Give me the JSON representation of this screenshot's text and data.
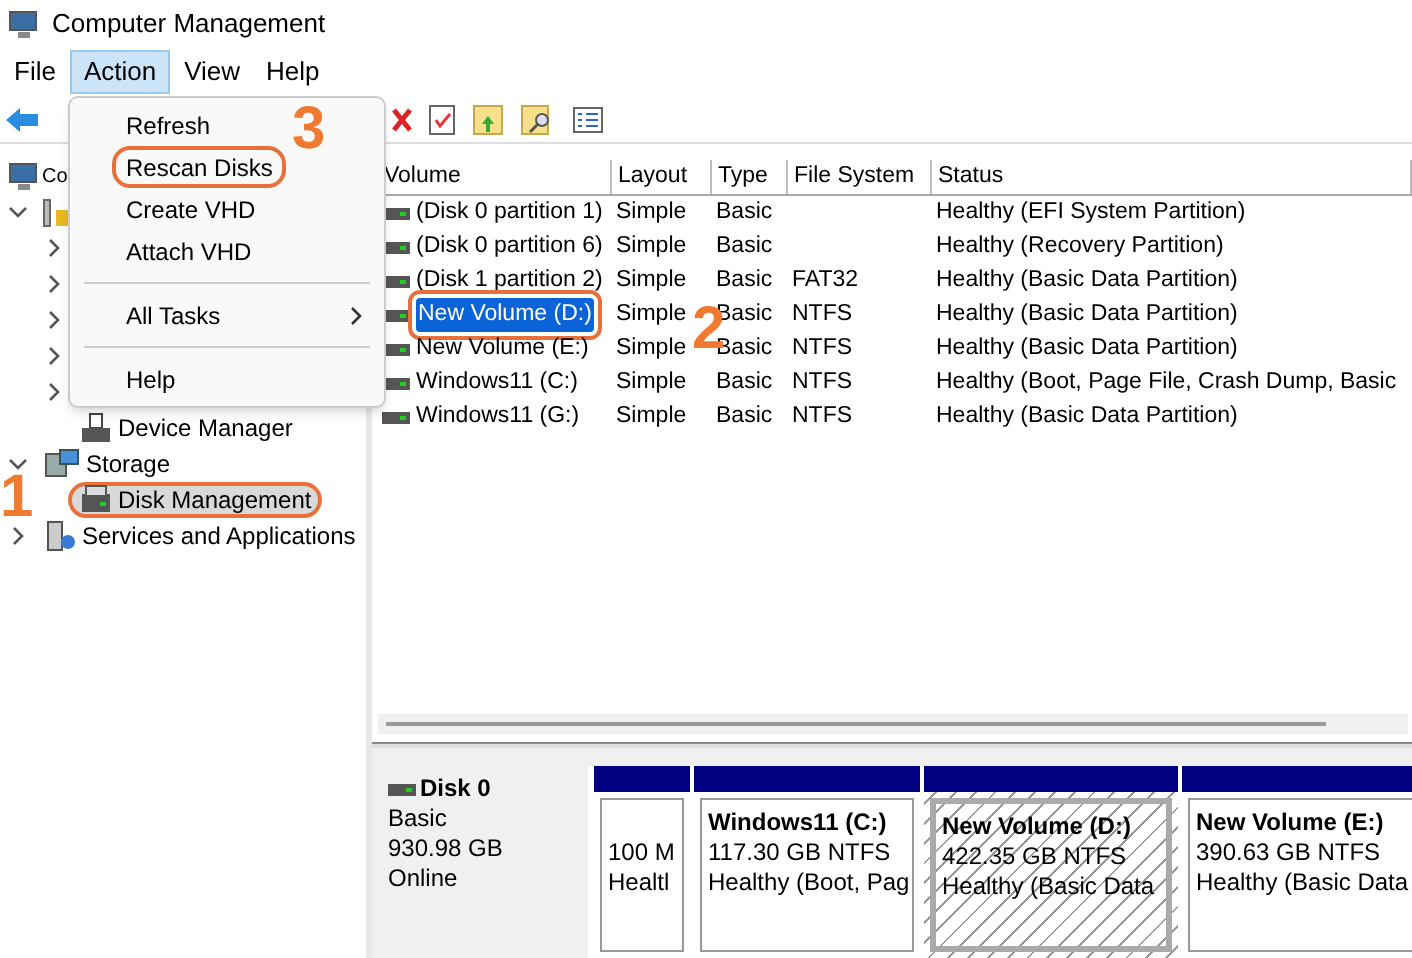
{
  "window": {
    "title": "Computer Management"
  },
  "menu_bar": [
    {
      "label": "File",
      "selected": false
    },
    {
      "label": "Action",
      "selected": true
    },
    {
      "label": "View",
      "selected": false
    },
    {
      "label": "Help",
      "selected": false
    }
  ],
  "action_menu": [
    {
      "kind": "item",
      "label": "Refresh",
      "highlighted": false
    },
    {
      "kind": "item",
      "label": "Rescan Disks",
      "highlighted": true
    },
    {
      "kind": "item",
      "label": "Create VHD",
      "highlighted": false
    },
    {
      "kind": "item",
      "label": "Attach VHD",
      "highlighted": false
    },
    {
      "kind": "separator"
    },
    {
      "kind": "submenu",
      "label": "All Tasks",
      "highlighted": false
    },
    {
      "kind": "separator"
    },
    {
      "kind": "item",
      "label": "Help",
      "highlighted": false
    }
  ],
  "tree": [
    {
      "kind": "computer",
      "label": "Co",
      "children": [
        {
          "kind": "tools",
          "expanded": true,
          "children": [
            {
              "expanded": false
            },
            {
              "expanded": false
            },
            {
              "expanded": false
            },
            {
              "expanded": false
            },
            {
              "expanded": false
            },
            {
              "kind": "device",
              "label": "Device Manager",
              "selected": false
            }
          ]
        },
        {
          "kind": "storage",
          "label": "Storage",
          "expanded": true,
          "selected": false,
          "children": [
            {
              "kind": "disk",
              "label": "Disk Management",
              "selected": true
            }
          ]
        },
        {
          "kind": "services",
          "label": "Services and Applications",
          "expanded": false,
          "selected": false
        }
      ]
    }
  ],
  "table": {
    "columns": [
      "Volume",
      "Layout",
      "Type",
      "File System",
      "Status"
    ],
    "rows": [
      {
        "cells": [
          "(Disk 0 partition 1)",
          "Simple",
          "Basic",
          "",
          "Healthy (EFI System Partition)"
        ],
        "selected": false
      },
      {
        "cells": [
          "(Disk 0 partition 6)",
          "Simple",
          "Basic",
          "",
          "Healthy (Recovery Partition)"
        ],
        "selected": false
      },
      {
        "cells": [
          "(Disk 1 partition 2)",
          "Simple",
          "Basic",
          "FAT32",
          "Healthy (Basic Data Partition)"
        ],
        "selected": false
      },
      {
        "cells": [
          "New Volume (D:)",
          "Simple",
          "Basic",
          "NTFS",
          "Healthy (Basic Data Partition)"
        ],
        "selected": true
      },
      {
        "cells": [
          "New Volume (E:)",
          "Simple",
          "Basic",
          "NTFS",
          "Healthy (Basic Data Partition)"
        ],
        "selected": false
      },
      {
        "cells": [
          "Windows11 (C:)",
          "Simple",
          "Basic",
          "NTFS",
          "Healthy (Boot, Page File, Crash Dump, Basic"
        ],
        "selected": false
      },
      {
        "cells": [
          "Windows11 (G:)",
          "Simple",
          "Basic",
          "NTFS",
          "Healthy (Basic Data Partition)"
        ],
        "selected": false
      }
    ]
  },
  "disk": {
    "name": "Disk 0",
    "type": "Basic",
    "size": "930.98 GB",
    "status": "Online",
    "partitions": [
      {
        "size": "100 M",
        "status": "Healtl",
        "selected": false
      },
      {
        "name": "Windows11  (C:)",
        "size": "117.30 GB NTFS",
        "status": "Healthy (Boot, Pag",
        "selected": false
      },
      {
        "name": "New Volume  (D:)",
        "size": "422.35 GB NTFS",
        "status": "Healthy (Basic Data",
        "selected": true
      },
      {
        "name": "New Volume  (E:)",
        "size": "390.63 GB NTFS",
        "status": "Healthy (Basic Data",
        "selected": false
      }
    ]
  },
  "annotations": [
    {
      "label": "1"
    },
    {
      "label": "2"
    },
    {
      "label": "3"
    }
  ]
}
